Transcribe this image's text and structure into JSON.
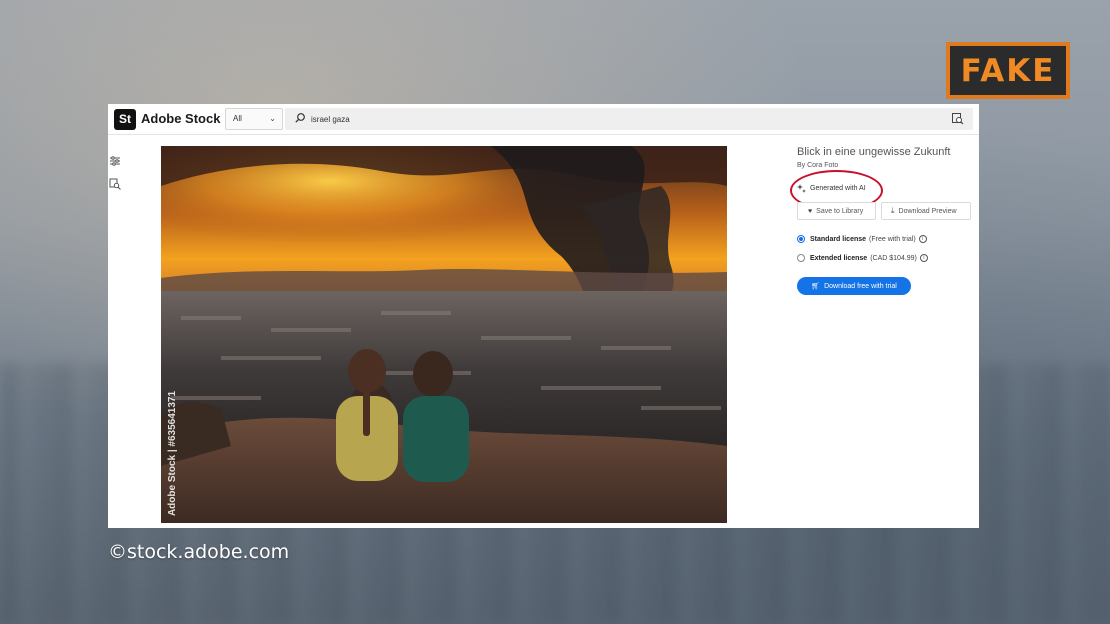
{
  "overlay": {
    "badge": "FAKE",
    "credit": "©stock.adobe.com"
  },
  "header": {
    "logo_mark": "St",
    "logo_text": "Adobe Stock",
    "filter_value": "All",
    "search_value": "israel gaza",
    "search_icon": "search-icon",
    "visual_search_icon": "visual-search-icon"
  },
  "sidebar": {
    "tools": [
      "filters-icon",
      "visual-search-icon"
    ]
  },
  "image": {
    "watermark": "Adobe Stock | #635641371"
  },
  "panel": {
    "title": "Blick in eine ungewisse Zukunft",
    "byline": "By Cora Foto",
    "generated_label": "Generated with AI",
    "save_label": "Save to Library",
    "preview_label": "Download Preview",
    "licenses": [
      {
        "name": "Standard license",
        "note": "(Free with trial)",
        "selected": true
      },
      {
        "name": "Extended license",
        "note": "(CAD $104.99)",
        "selected": false
      }
    ],
    "download_label": "Download free with trial"
  },
  "colors": {
    "accent": "#1473e6",
    "badge_border": "#e07a1f",
    "highlight_circle": "#c8102e"
  }
}
